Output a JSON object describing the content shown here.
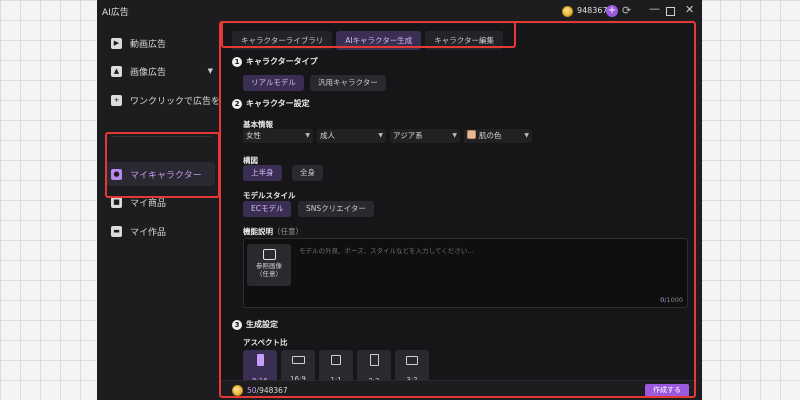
{
  "app": {
    "title": "AI広告",
    "credits": "948367"
  },
  "sidebar": {
    "items": [
      {
        "label": "動画広告",
        "icon": "video-icon"
      },
      {
        "label": "画像広告",
        "icon": "image-icon"
      },
      {
        "label": "ワンクリックで広告を...",
        "icon": "add-icon"
      },
      {
        "label": "マイキャラクター",
        "icon": "user-icon",
        "active": true
      },
      {
        "label": "マイ商品",
        "icon": "bag-icon"
      },
      {
        "label": "マイ作品",
        "icon": "folder-icon"
      }
    ]
  },
  "tabs": [
    {
      "label": "キャラクターライブラリ"
    },
    {
      "label": "AIキャラクター生成",
      "active": true
    },
    {
      "label": "キャラクター編集"
    }
  ],
  "section1": {
    "num": "1",
    "title": "キャラクタータイプ",
    "options": [
      "リアルモデル",
      "汎用キャラクター"
    ],
    "selected": "リアルモデル"
  },
  "section2": {
    "num": "2",
    "title": "キャラクター設定",
    "basic_label": "基本情報",
    "dropdowns": {
      "gender": "女性",
      "age": "成人",
      "ethnicity": "アジア系",
      "skin": "肌の色"
    },
    "composition_label": "構図",
    "composition_options": [
      "上半身",
      "全身"
    ],
    "composition_selected": "上半身",
    "style_label": "モデルスタイル",
    "style_options": [
      "ECモデル",
      "SNSクリエイター"
    ],
    "style_selected": "ECモデル",
    "desc_label": "機能説明",
    "desc_optional": "（任意）",
    "desc_placeholder": "モデルの外見、ポーズ、スタイルなどを入力してください...",
    "ref_label": "参照画像",
    "ref_optional": "（任意）",
    "char_count": "0",
    "char_max": "/1000"
  },
  "section3": {
    "num": "3",
    "title": "生成設定",
    "aspect_label": "アスペクト比",
    "aspects": [
      "9:16",
      "16:9",
      "1:1",
      "2:3",
      "3:2"
    ],
    "aspect_selected": "9:16"
  },
  "footer": {
    "cost": "50",
    "total": "/948367",
    "create_label": "作成する"
  },
  "colors": {
    "accent": "#9b59e0",
    "highlight_box": "#e53935"
  }
}
